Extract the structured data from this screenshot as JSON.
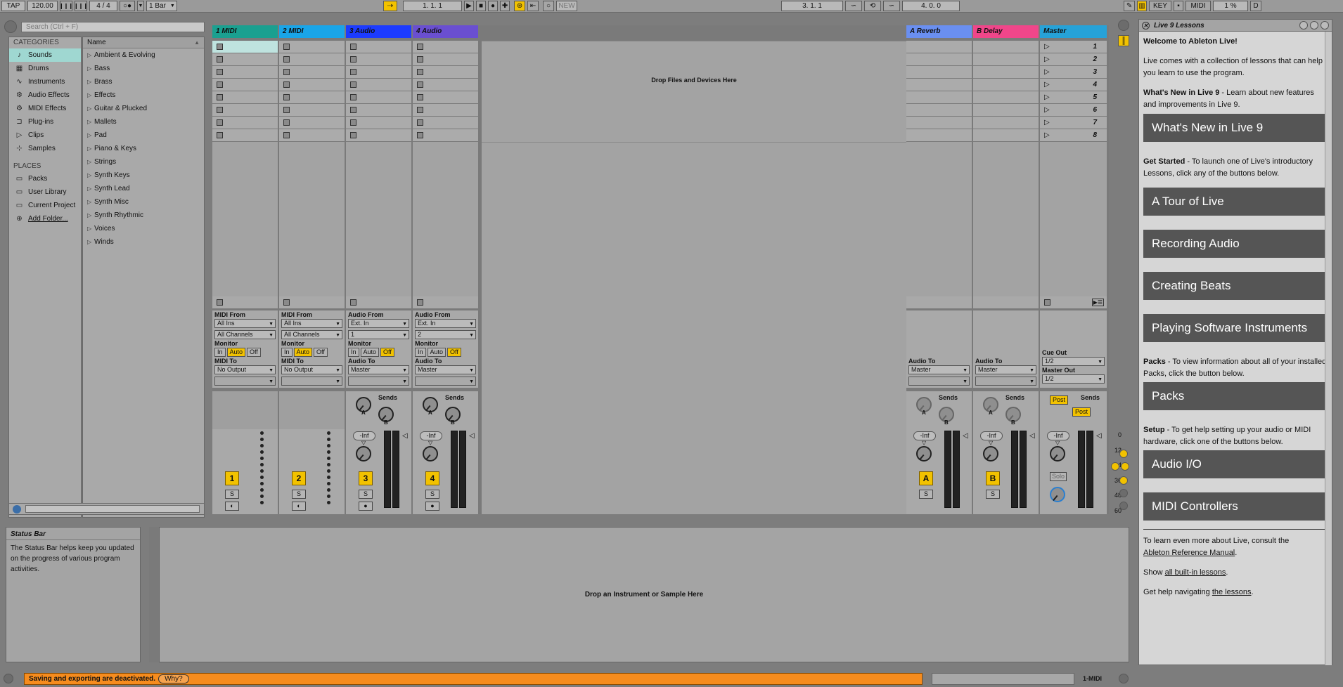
{
  "control_bar": {
    "tap": "TAP",
    "tempo": "120.00",
    "signature_num": "4",
    "signature_slash": "/",
    "signature_den": "4",
    "quantize": "1 Bar",
    "position": "1.   1.   1",
    "new_label": "NEW",
    "loop_start": "3.   1.   1",
    "loop_length": "4.   0.   0",
    "key_label": "KEY",
    "midi_label": "MIDI",
    "cpu": "1 %",
    "d_label": "D"
  },
  "browser": {
    "search_placeholder": "Search (Ctrl + F)",
    "categories_header": "CATEGORIES",
    "categories": [
      {
        "label": "Sounds",
        "icon": "note-icon"
      },
      {
        "label": "Drums",
        "icon": "grid-icon"
      },
      {
        "label": "Instruments",
        "icon": "wave-icon"
      },
      {
        "label": "Audio Effects",
        "icon": "fx-icon"
      },
      {
        "label": "MIDI Effects",
        "icon": "fx-icon"
      },
      {
        "label": "Plug-ins",
        "icon": "plug-icon"
      },
      {
        "label": "Clips",
        "icon": "clip-icon"
      },
      {
        "label": "Samples",
        "icon": "sample-icon"
      }
    ],
    "places_header": "PLACES",
    "places": [
      {
        "label": "Packs"
      },
      {
        "label": "User Library"
      },
      {
        "label": "Current Project"
      },
      {
        "label": "Add Folder..."
      }
    ],
    "name_header": "Name",
    "names": [
      "Ambient & Evolving",
      "Bass",
      "Brass",
      "Effects",
      "Guitar & Plucked",
      "Mallets",
      "Pad",
      "Piano & Keys",
      "Strings",
      "Synth Keys",
      "Synth Lead",
      "Synth Misc",
      "Synth Rhythmic",
      "Voices",
      "Winds"
    ]
  },
  "session": {
    "tracks": [
      {
        "name": "1 MIDI",
        "color": "#1aa090",
        "type": "midi",
        "from_label": "MIDI From",
        "from": "All Ins",
        "channel": "All Channels",
        "to_label": "MIDI To",
        "to": "No Output",
        "num": "1"
      },
      {
        "name": "2 MIDI",
        "color": "#19a5e8",
        "type": "midi",
        "from_label": "MIDI From",
        "from": "All Ins",
        "channel": "All Channels",
        "to_label": "MIDI To",
        "to": "No Output",
        "num": "2"
      },
      {
        "name": "3 Audio",
        "color": "#1c3bff",
        "type": "audio",
        "from_label": "Audio From",
        "from": "Ext. In",
        "channel": "1",
        "to_label": "Audio To",
        "to": "Master",
        "num": "3",
        "vol": "-Inf"
      },
      {
        "name": "4 Audio",
        "color": "#6a4fd0",
        "type": "audio",
        "from_label": "Audio From",
        "from": "Ext. In",
        "channel": "2",
        "to_label": "Audio To",
        "to": "Master",
        "num": "4",
        "vol": "-Inf"
      }
    ],
    "returns": [
      {
        "name": "A Reverb",
        "color": "#6a8ff0",
        "to_label": "Audio To",
        "to": "Master",
        "num": "A",
        "vol": "-Inf"
      },
      {
        "name": "B Delay",
        "color": "#f0468a",
        "to_label": "Audio To",
        "to": "Master",
        "num": "B",
        "vol": "-Inf"
      }
    ],
    "master": {
      "name": "Master",
      "color": "#26a2d8",
      "scenes": [
        "1",
        "2",
        "3",
        "4",
        "5",
        "6",
        "7",
        "8"
      ],
      "cue_label": "Cue Out",
      "cue": "1/2",
      "out_label": "Master Out",
      "out": "1/2",
      "post1": "Post",
      "post2": "Post",
      "vol": "-Inf",
      "solo": "Solo"
    },
    "monitor_label": "Monitor",
    "monitor_options": [
      "In",
      "Auto",
      "Off"
    ],
    "sends_label": "Sends",
    "send_a": "A",
    "send_b": "B",
    "solo_label": "S",
    "drop_files": "Drop Files and Devices Here",
    "meter_ticks": [
      "0",
      "12",
      "24",
      "36",
      "48",
      "60"
    ]
  },
  "info": {
    "title": "Status Bar",
    "body": "The Status Bar helps keep you updated on the progress of various program activities."
  },
  "detail": {
    "drop": "Drop an Instrument or Sample Here"
  },
  "lessons": {
    "title": "Live 9 Lessons",
    "welcome": "Welcome to Ableton Live!",
    "intro": "Live comes with a collection of lessons that can help you learn to use the program.",
    "whatsnew_bold": "What's New in Live 9",
    "whatsnew_text": " - Learn about new features and improvements in Live 9.",
    "btn_whatsnew": "What's New in Live 9",
    "getstarted_bold": "Get Started",
    "getstarted_text": " - To launch one of Live's introductory Lessons, click any of the buttons below.",
    "btn_tour": "A Tour of Live",
    "btn_recording": "Recording Audio",
    "btn_beats": "Creating Beats",
    "btn_instruments": "Playing Software Instruments",
    "packs_bold": "Packs",
    "packs_text": " - To view information about all of your installed Packs, click the button below.",
    "btn_packs": "Packs",
    "setup_bold": "Setup",
    "setup_text": " - To get help setting up your audio or MIDI hardware, click one of the buttons below.",
    "btn_audio": "Audio I/O",
    "btn_midi": "MIDI Controllers",
    "learn_text": "To learn even more about Live, consult the",
    "manual_link": "Ableton Reference Manual",
    "show_text": "Show",
    "all_link": "all built-in lessons",
    "navigate_text": "Get help navigating",
    "lessons_link": "the lessons"
  },
  "status": {
    "message": "Saving and exporting are deactivated.",
    "why": "Why?",
    "selected_track": "1-MIDI"
  }
}
